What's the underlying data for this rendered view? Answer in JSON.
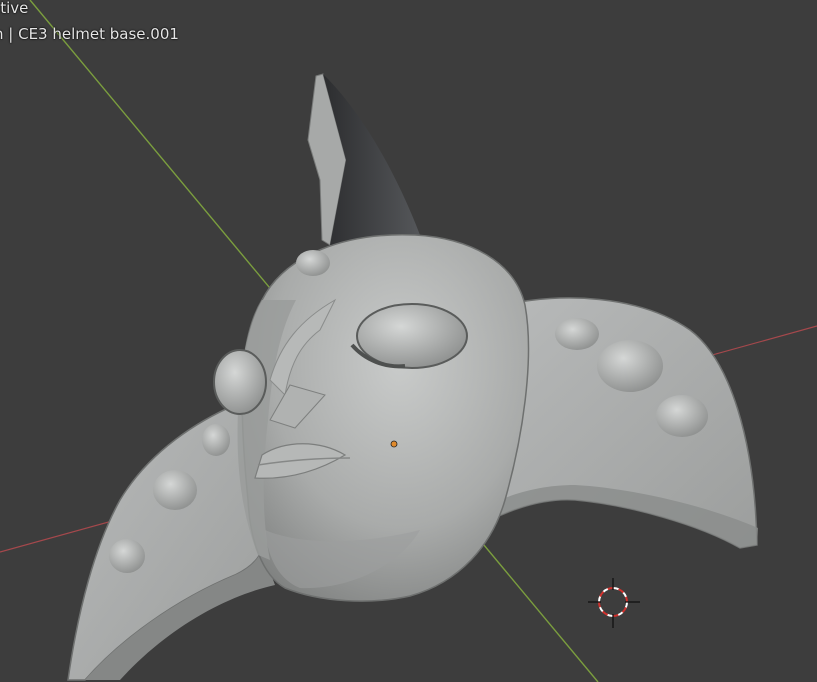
{
  "viewport": {
    "view_label": "User Perspective",
    "view_label_visible": "ctive",
    "collection_object": "n | CE3 helmet base.001",
    "background_color": "#3d3d3d"
  },
  "scene": {
    "object_name": "CE3 helmet base.001",
    "icons": [
      "3d-cursor-icon",
      "object-origin-icon"
    ],
    "axis_colors": {
      "x_axis": "#a5484c",
      "y_axis": "#7b9e3e"
    }
  }
}
